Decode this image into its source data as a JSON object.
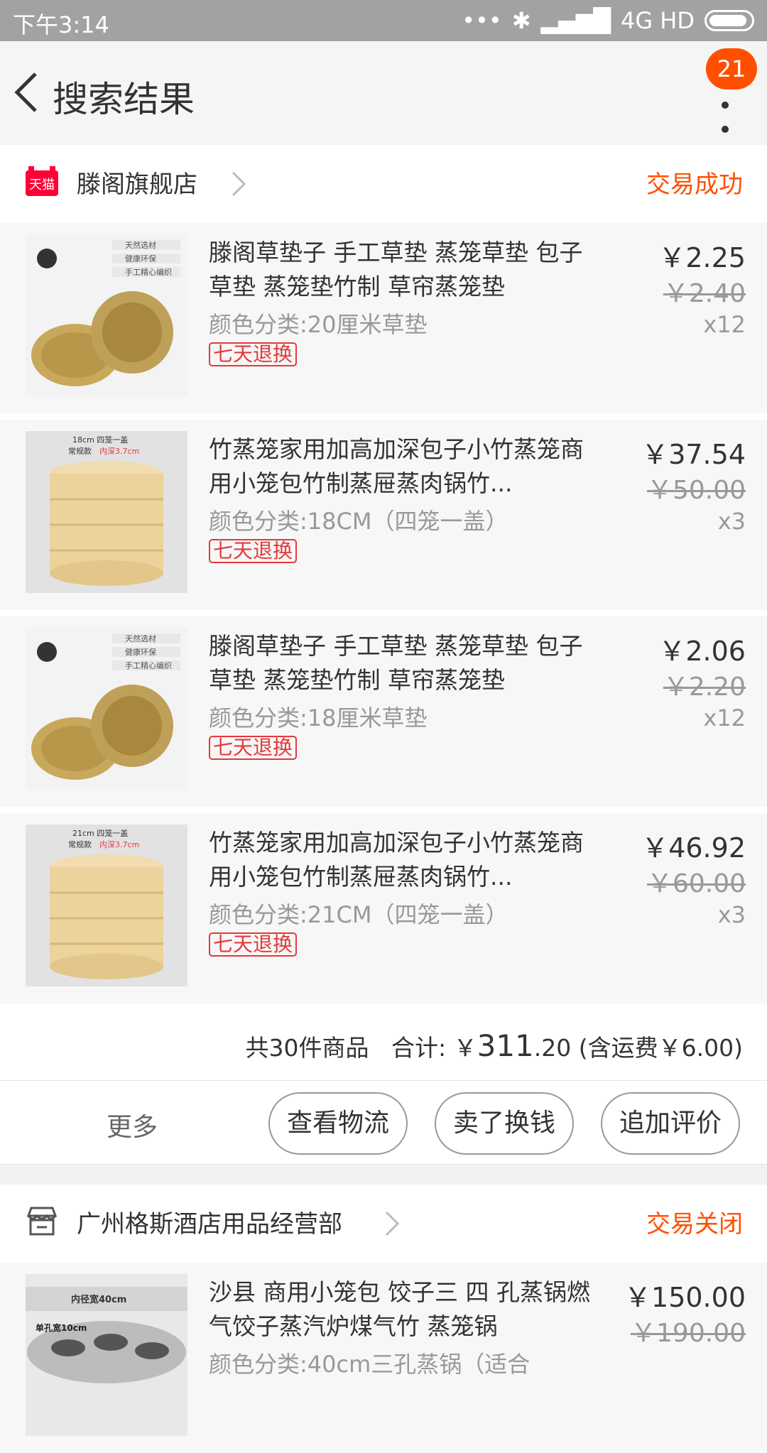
{
  "status_bar": {
    "time": "下午3:14",
    "network": "4G HD"
  },
  "nav": {
    "title": "搜索结果",
    "badge": "21"
  },
  "orders": [
    {
      "shop_name": "滕阁旗舰店",
      "shop_badge": "天猫",
      "status": "交易成功",
      "items": [
        {
          "title": "滕阁草垫子 手工草垫 蒸笼草垫 包子草垫 蒸笼垫竹制 草帘蒸笼垫",
          "sku": "颜色分类:20厘米草垫",
          "tag": "七天退换",
          "price": "￥2.25",
          "orig_price": "￥2.40",
          "qty": "x12"
        },
        {
          "title": "竹蒸笼家用加高加深包子小竹蒸笼商用小笼包竹制蒸屉蒸肉锅竹...",
          "sku": "颜色分类:18CM（四笼一盖）",
          "tag": "七天退换",
          "price": "￥37.54",
          "orig_price": "￥50.00",
          "qty": "x3",
          "thumb_caption": "18cm 四笼一盖"
        },
        {
          "title": "滕阁草垫子 手工草垫 蒸笼草垫 包子草垫 蒸笼垫竹制 草帘蒸笼垫",
          "sku": "颜色分类:18厘米草垫",
          "tag": "七天退换",
          "price": "￥2.06",
          "orig_price": "￥2.20",
          "qty": "x12"
        },
        {
          "title": "竹蒸笼家用加高加深包子小竹蒸笼商用小笼包竹制蒸屉蒸肉锅竹...",
          "sku": "颜色分类:21CM（四笼一盖）",
          "tag": "七天退换",
          "price": "￥46.92",
          "orig_price": "￥60.00",
          "qty": "x3",
          "thumb_caption": "21cm 四笼一盖"
        }
      ],
      "summary": {
        "count_text": "共30件商品",
        "total_label": "合计: ￥",
        "total_int": "311",
        "total_dec": ".20",
        "shipping": "(含运费￥6.00)"
      },
      "actions": {
        "more": "更多",
        "buttons": [
          "查看物流",
          "卖了换钱",
          "追加评价"
        ]
      }
    },
    {
      "shop_name": "广州格斯酒店用品经营部",
      "status": "交易关闭",
      "items": [
        {
          "title": "沙县 商用小笼包 饺子三 四 孔蒸锅燃气饺子蒸汽炉煤气竹 蒸笼锅",
          "sku": "颜色分类:40cm三孔蒸锅（适合",
          "price": "￥150.00",
          "orig_price": "￥190.00",
          "thumb_caption": "内径宽40cm"
        }
      ]
    }
  ],
  "thumb_text": {
    "grass1": "天然选材",
    "grass2": "健康环保",
    "grass3": "手工精心编织",
    "steamer_sub": "常规款",
    "steamer_depth": "内深3.7cm",
    "pot_label": "单孔宽10cm"
  },
  "colors": {
    "accent": "#ff5000",
    "tag_red": "#e4393c",
    "tmall_red": "#ff0036"
  }
}
